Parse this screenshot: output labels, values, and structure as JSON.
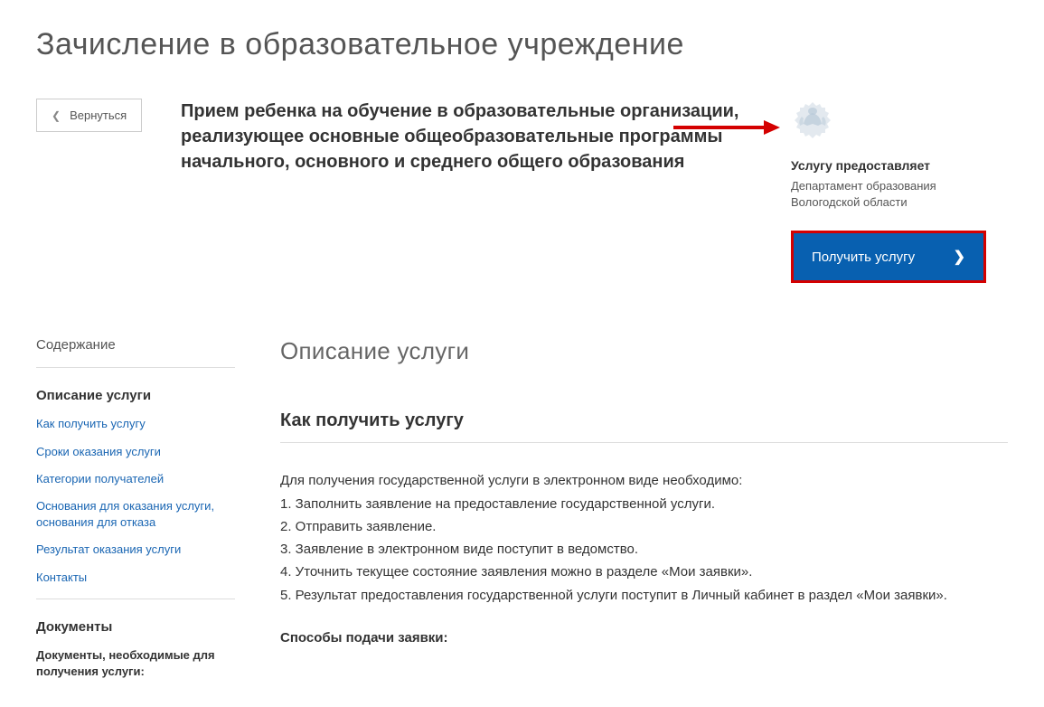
{
  "page": {
    "title": "Зачисление в образовательное учреждение",
    "subtitle": "Прием ребенка на обучение в образовательные организации, реализующее основные общеобразовательные программы начального, основного и среднего общего образования"
  },
  "back_button": {
    "label": "Вернуться"
  },
  "provider": {
    "label": "Услугу предоставляет",
    "name": "Департамент образования Вологодской области",
    "action_label": "Получить услугу"
  },
  "sidebar": {
    "toc_title": "Содержание",
    "section1_heading": "Описание услуги",
    "links": {
      "l1": "Как получить услугу",
      "l2": "Сроки оказания услуги",
      "l3": "Категории получателей",
      "l4": "Основания для оказания услуги, основания для отказа",
      "l5": "Результат оказания услуги",
      "l6": "Контакты"
    },
    "section2_heading": "Документы",
    "section2_sub": "Документы, необходимые для получения услуги:"
  },
  "content": {
    "title": "Описание услуги",
    "section_heading": "Как получить услугу",
    "lead": "Для получения государственной услуги в электронном виде необходимо:",
    "step1": "1. Заполнить заявление на предоставление государственной услуги.",
    "step2": "2. Отправить заявление.",
    "step3": "3. Заявление в электронном виде поступит в ведомство.",
    "step4": "4. Уточнить текущее состояние заявления можно в разделе «Мои заявки».",
    "step5": "5. Результат предоставления государственной услуги поступит в Личный кабинет в раздел «Мои заявки».",
    "methods_heading": "Способы подачи заявки:"
  }
}
